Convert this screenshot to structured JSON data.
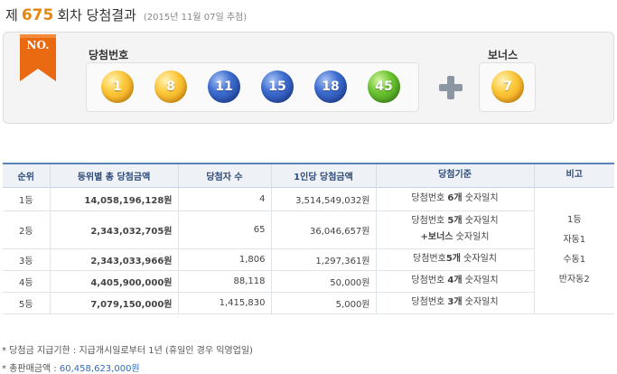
{
  "header": {
    "lead": "제",
    "round": "675",
    "main": "회차 당첨결과",
    "date": "(2015년 11월 07일 추첨)"
  },
  "draw": {
    "badge": "NO.",
    "numbers_label": "당첨번호",
    "bonus_label": "보너스",
    "numbers": [
      "1",
      "8",
      "11",
      "15",
      "18",
      "45"
    ],
    "bonus": "7",
    "ball_colors": {
      "yellow": "#fcc83a",
      "blue": "#3d6cd0",
      "green": "#6cc430"
    }
  },
  "table": {
    "headers": [
      "순위",
      "등위별 총 당첨금액",
      "당첨자 수",
      "1인당 당첨금액",
      "당첨기준",
      "비고"
    ],
    "rows": [
      {
        "rank": "1등",
        "total": "14,058,196,128원",
        "count": "4",
        "per": "3,514,549,032원",
        "crit_a": "당첨번호 ",
        "crit_b": "6개",
        "crit_c": " 숫자일치"
      },
      {
        "rank": "2등",
        "total": "2,343,032,705원",
        "count": "65",
        "per": "36,046,657원",
        "crit_a": "당첨번호 ",
        "crit_b": "5개",
        "crit_c": " 숫자일치",
        "crit_d": "+보너스",
        "crit_e": " 숫자일치"
      },
      {
        "rank": "3등",
        "total": "2,343,033,966원",
        "count": "1,806",
        "per": "1,297,361원",
        "crit_a": "당첨번호",
        "crit_b": "5개",
        "crit_c": " 숫자일치"
      },
      {
        "rank": "4등",
        "total": "4,405,900,000원",
        "count": "88,118",
        "per": "50,000원",
        "crit_a": "당첨번호 ",
        "crit_b": "4개",
        "crit_c": " 숫자일치"
      },
      {
        "rank": "5등",
        "total": "7,079,150,000원",
        "count": "1,415,830",
        "per": "5,000원",
        "crit_a": "당첨번호 ",
        "crit_b": "3개",
        "crit_c": " 숫자일치"
      }
    ],
    "note": [
      "1등",
      "자동1",
      "수동1",
      "반자동2"
    ]
  },
  "footer": {
    "deadline": "* 당첨금 지급기한 : 지급개시일로부터 1년 (휴일인 경우 익영업일)",
    "sales_label": "* 총판매금액 : ",
    "sales_amount": "60,458,623,000원"
  },
  "icons": {
    "plus": "plus-icon",
    "badge": "ribbon-badge-icon"
  }
}
